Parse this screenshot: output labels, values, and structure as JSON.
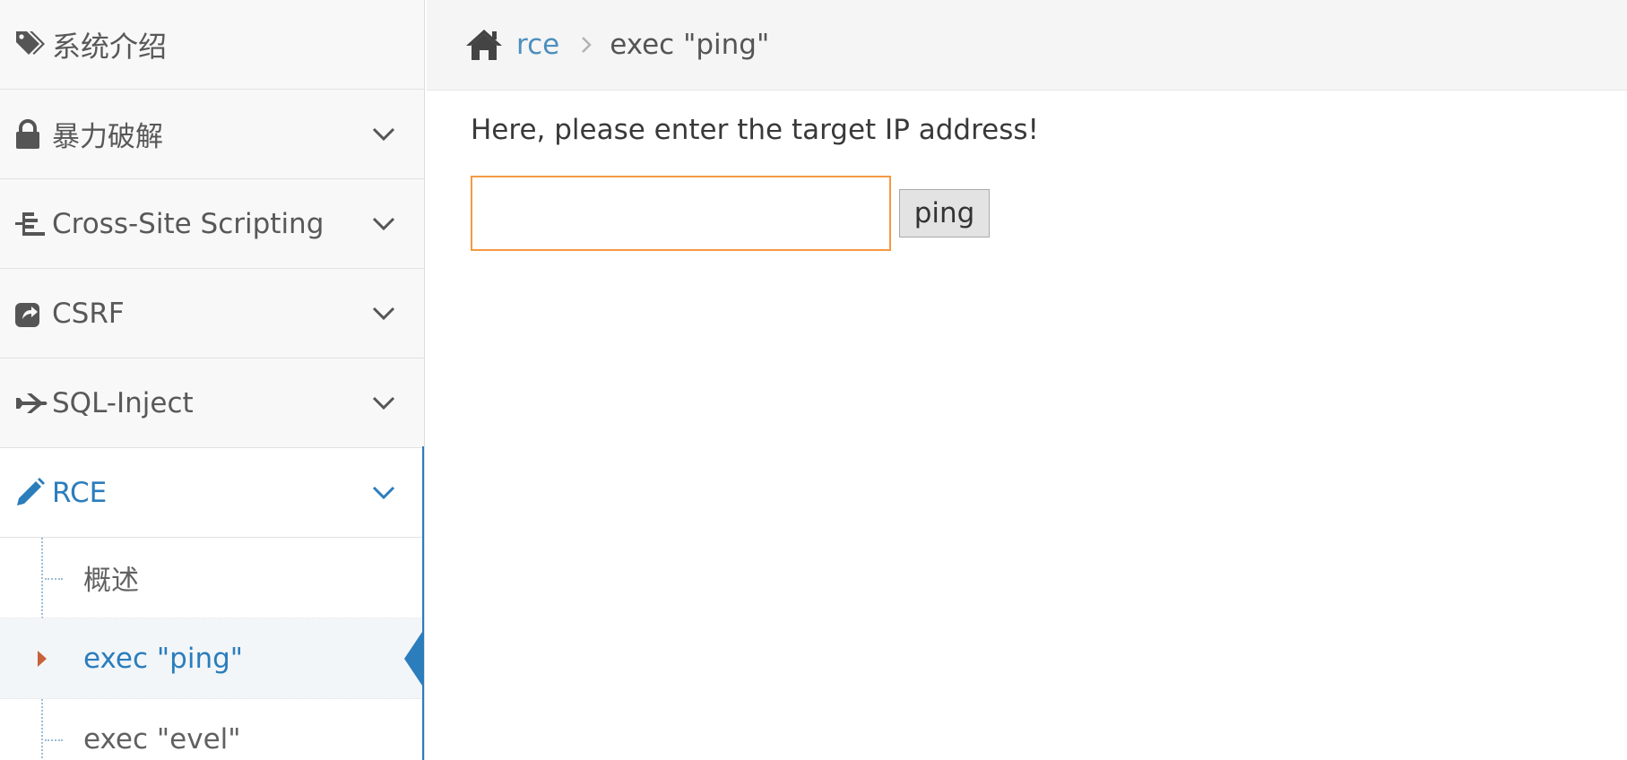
{
  "sidebar": {
    "items": [
      {
        "label": "系统介绍",
        "icon": "tags-icon"
      },
      {
        "label": "暴力破解",
        "icon": "lock-icon"
      },
      {
        "label": "Cross-Site Scripting",
        "icon": "tree-icon"
      },
      {
        "label": "CSRF",
        "icon": "share-icon"
      },
      {
        "label": "SQL-Inject",
        "icon": "plane-icon"
      },
      {
        "label": "RCE",
        "icon": "pencil-icon",
        "active": true
      }
    ],
    "submenu": [
      {
        "label": "概述"
      },
      {
        "label": "exec \"ping\"",
        "current": true
      },
      {
        "label": "exec \"evel\""
      }
    ]
  },
  "breadcrumb": {
    "home_icon": "home-icon",
    "link": "rce",
    "current": "exec \"ping\""
  },
  "main": {
    "prompt": "Here, please enter the target IP address!",
    "input_value": "",
    "button_label": "ping"
  },
  "colors": {
    "accent": "#2b7dbc",
    "input_focus_border": "#f59942",
    "caret": "#c86139"
  }
}
